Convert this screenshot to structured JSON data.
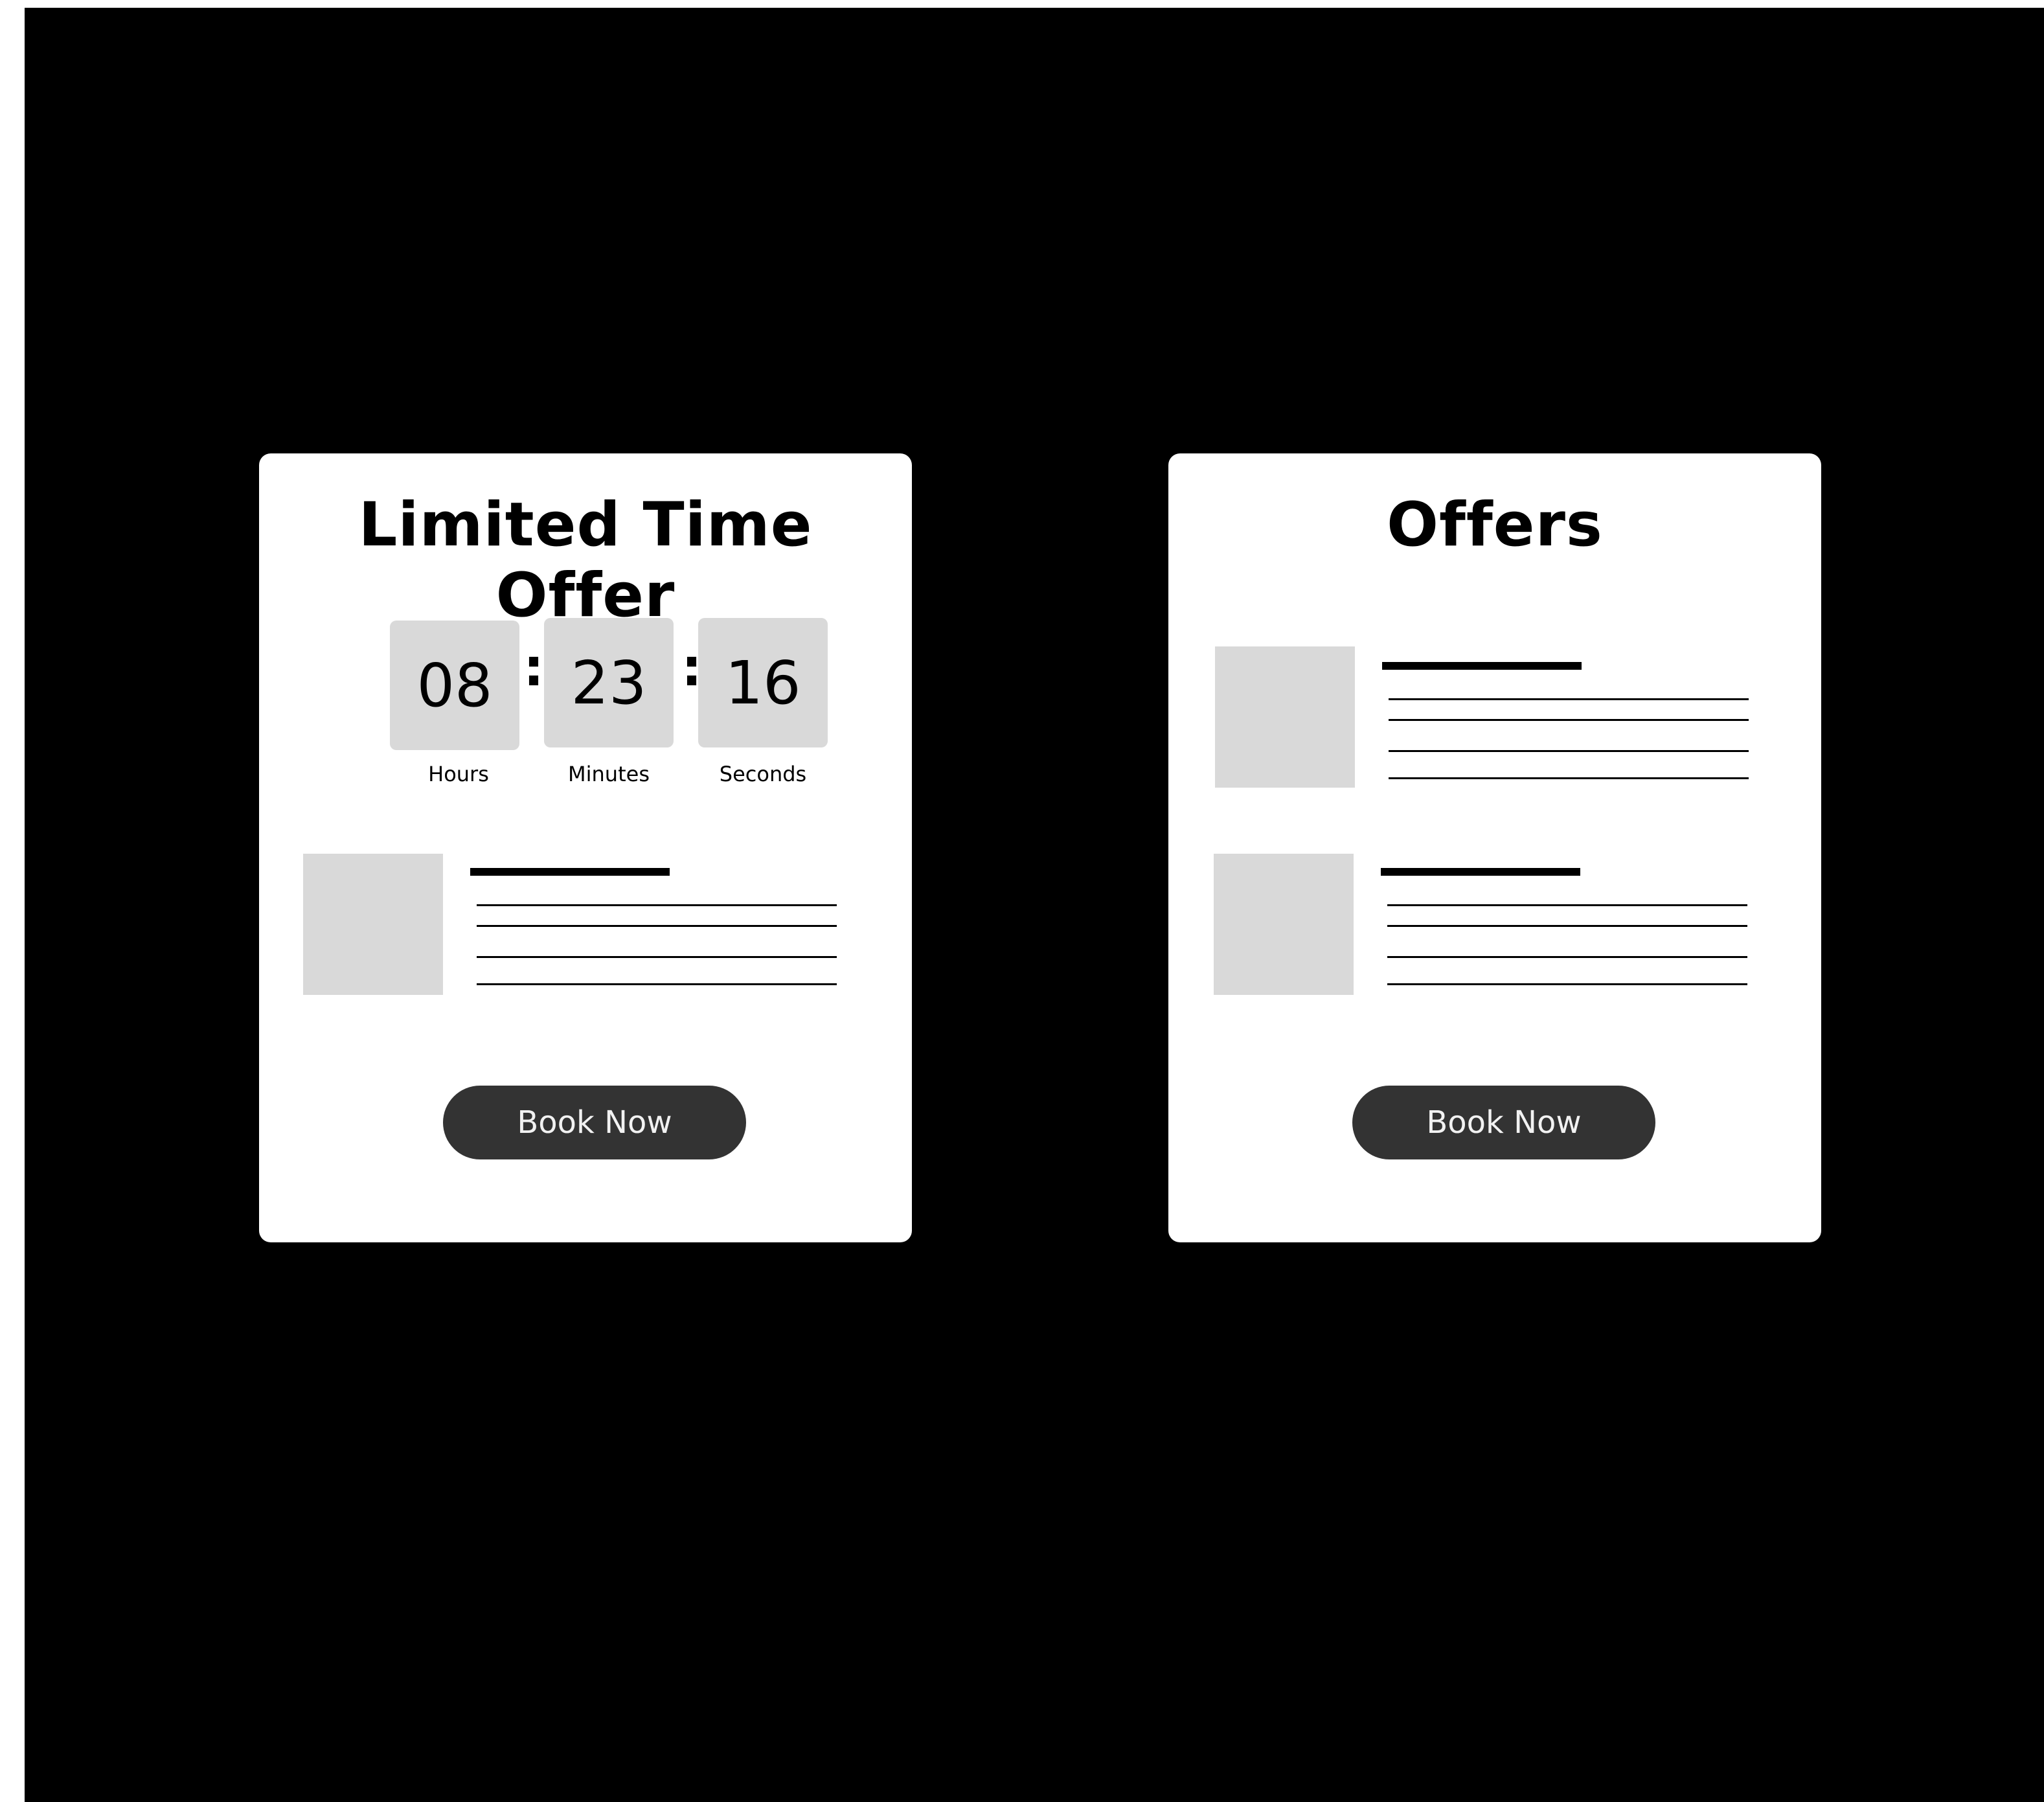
{
  "colors": {
    "background": "#000000",
    "card": "#ffffff",
    "placeholder": "#d9d9d9",
    "button": "#333333",
    "button_text": "#f2f2f2"
  },
  "left_card": {
    "title": "Limited Time Offer",
    "countdown": {
      "hours": "08",
      "minutes": "23",
      "seconds": "16",
      "separator": ":",
      "hours_label": "Hours",
      "minutes_label": "Minutes",
      "seconds_label": "Seconds"
    },
    "button_label": "Book Now"
  },
  "right_card": {
    "title": "Offers",
    "button_label": "Book Now"
  }
}
